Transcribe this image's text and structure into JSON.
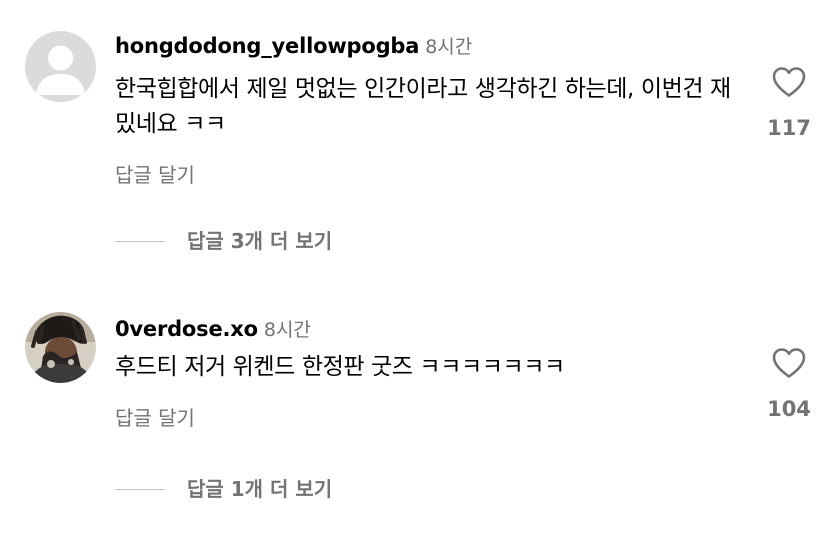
{
  "comments": [
    {
      "username": "hongdodong_yellowpogba",
      "time": "8시간",
      "text": "한국힙합에서 제일 멋없는 인간이라고 생각하긴 하는데, 이번건 재밌네요 ㅋㅋ",
      "reply_label": "답글 달기",
      "likes": "117",
      "view_replies": "답글 3개 더 보기",
      "avatar_icon": "default-avatar-icon"
    },
    {
      "username": "0verdose.xo",
      "time": "8시간",
      "text": "후드티 저거 위켄드 한정판 굿즈 ㅋㅋㅋㅋㅋㅋㅋ",
      "reply_label": "답글 달기",
      "likes": "104",
      "view_replies": "답글 1개 더 보기",
      "avatar_icon": "profile-photo"
    }
  ],
  "icons": {
    "like": "heart-outline-icon"
  },
  "colors": {
    "primary_text": "#000000",
    "secondary_text": "#737373",
    "divider": "#c7c7c7",
    "default_avatar_bg": "#dbdbdb"
  }
}
